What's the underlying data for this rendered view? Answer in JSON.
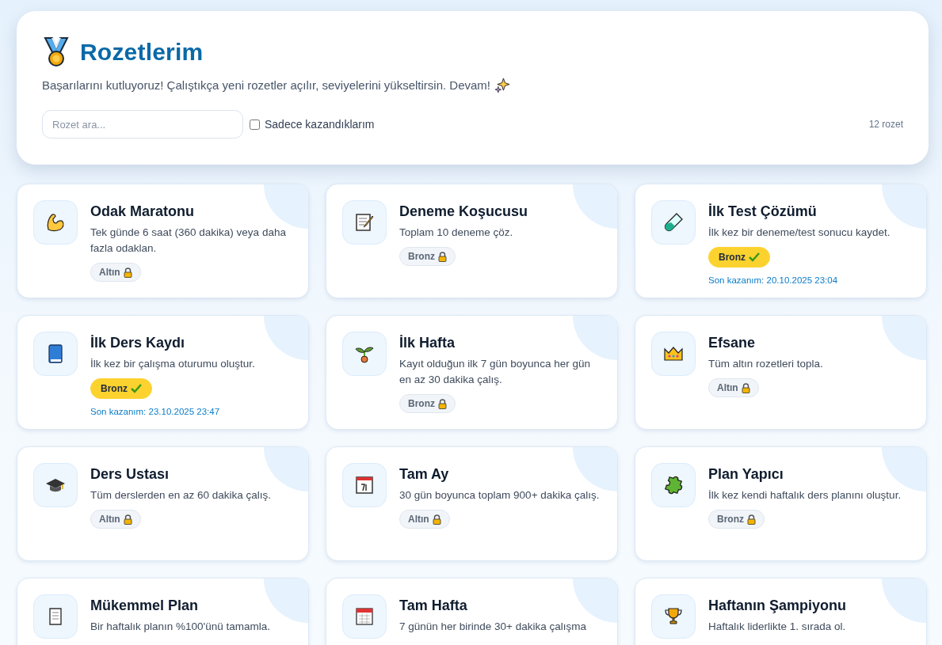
{
  "header": {
    "title": "Rozetlerim",
    "subtitle": "Başarılarını kutluyoruz! Çalıştıkça yeni rozetler açılır, seviyelerini yükseltirsin. Devam!",
    "search": {
      "placeholder": "Rozet ara..."
    },
    "filter": {
      "label": "Sadece kazandıklarım",
      "checked": false
    },
    "count": "12 rozet"
  },
  "badges": [
    {
      "title": "Odak Maratonu",
      "description": "Tek günde 6 saat (360 dakika) veya daha fazla odaklan.",
      "tier": "Altın",
      "earned": false
    },
    {
      "title": "Deneme Koşucusu",
      "description": "Toplam 10 deneme çöz.",
      "tier": "Bronz",
      "earned": false
    },
    {
      "title": "İlk Test Çözümü",
      "description": "İlk kez bir deneme/test sonucu kaydet.",
      "tier": "Bronz",
      "earned": true,
      "earned_at": "Son kazanım: 20.10.2025 23:04"
    },
    {
      "title": "İlk Ders Kaydı",
      "description": "İlk kez bir çalışma oturumu oluştur.",
      "tier": "Bronz",
      "earned": true,
      "earned_at": "Son kazanım: 23.10.2025 23:47"
    },
    {
      "title": "İlk Hafta",
      "description": "Kayıt olduğun ilk 7 gün boyunca her gün en az 30 dakika çalış.",
      "tier": "Bronz",
      "earned": false
    },
    {
      "title": "Efsane",
      "description": "Tüm altın rozetleri topla.",
      "tier": "Altın",
      "earned": false
    },
    {
      "title": "Ders Ustası",
      "description": "Tüm derslerden en az 60 dakika çalış.",
      "tier": "Altın",
      "earned": false
    },
    {
      "title": "Tam Ay",
      "description": "30 gün boyunca toplam 900+ dakika çalış.",
      "tier": "Altın",
      "earned": false
    },
    {
      "title": "Plan Yapıcı",
      "description": "İlk kez kendi haftalık ders planını oluştur.",
      "tier": "Bronz",
      "earned": false
    },
    {
      "title": "Mükemmel Plan",
      "description": "Bir haftalık planın %100'ünü tamamla."
    },
    {
      "title": "Tam Hafta",
      "description": "7 günün her birinde 30+ dakika çalışma"
    },
    {
      "title": "Haftanın Şampiyonu",
      "description": "Haftalık liderlikte 1. sırada ol."
    }
  ]
}
